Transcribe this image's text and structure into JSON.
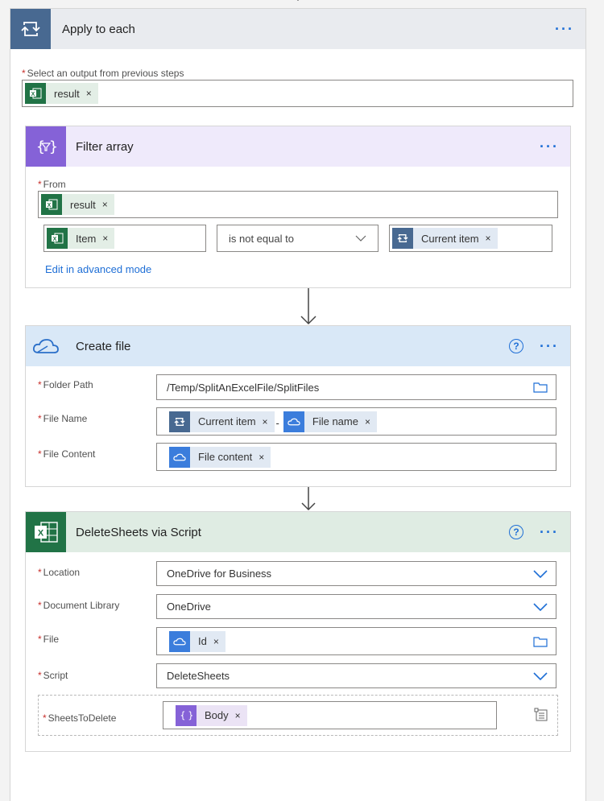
{
  "apply_each": {
    "title": "Apply to each",
    "select_label": "Select an output from previous steps",
    "token": "result"
  },
  "filter_array": {
    "title": "Filter array",
    "from_label": "From",
    "from_token": "result",
    "left_token": "Item",
    "operator": "is not equal to",
    "right_token": "Current item",
    "advanced_link": "Edit in advanced mode"
  },
  "create_file": {
    "title": "Create file",
    "folder_label": "Folder Path",
    "folder_value": "/Temp/SplitAnExcelFile/SplitFiles",
    "name_label": "File Name",
    "name_token1": "Current item",
    "name_sep": "-",
    "name_token2": "File name",
    "content_label": "File Content",
    "content_token": "File content"
  },
  "delete_sheets": {
    "title": "DeleteSheets via Script",
    "location_label": "Location",
    "location_value": "OneDrive for Business",
    "doclib_label": "Document Library",
    "doclib_value": "OneDrive",
    "file_label": "File",
    "file_token": "Id",
    "script_label": "Script",
    "script_value": "DeleteSheets",
    "sheets_label": "SheetsToDelete",
    "sheets_token": "Body"
  },
  "common": {
    "more_dots": "···",
    "help": "?",
    "remove": "×"
  },
  "colors": {
    "excel": "#217346",
    "onedrive": "#3b7ddc",
    "loop": "#486991",
    "variable": "#8562d7",
    "link": "#1f6fd6"
  }
}
